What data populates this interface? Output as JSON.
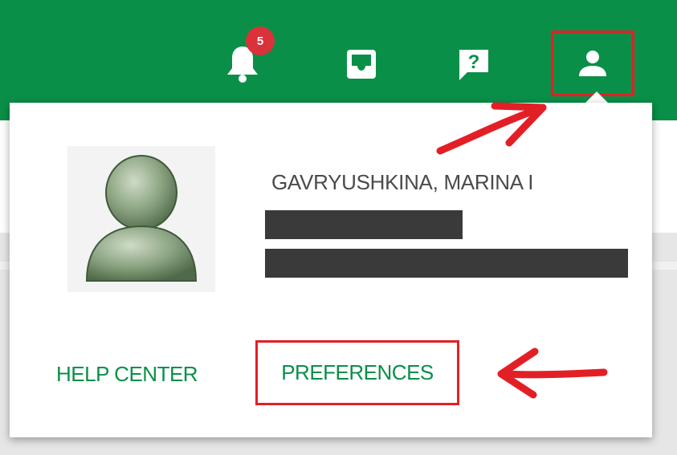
{
  "header": {
    "notifications_badge": "5",
    "bell_icon": "bell-icon",
    "inbox_icon": "inbox-icon",
    "help_icon": "help-question-icon",
    "user_icon": "user-icon",
    "bar_color": "#0a8f48"
  },
  "profile": {
    "name": "GAVRYUSHKINA, MARINA I",
    "avatar_icon": "default-user-avatar"
  },
  "links": {
    "help_center": "HELP CENTER",
    "preferences": "PREFERENCES",
    "color": "#0a8f48"
  },
  "annotations": {
    "highlight_color": "#e31f26"
  }
}
